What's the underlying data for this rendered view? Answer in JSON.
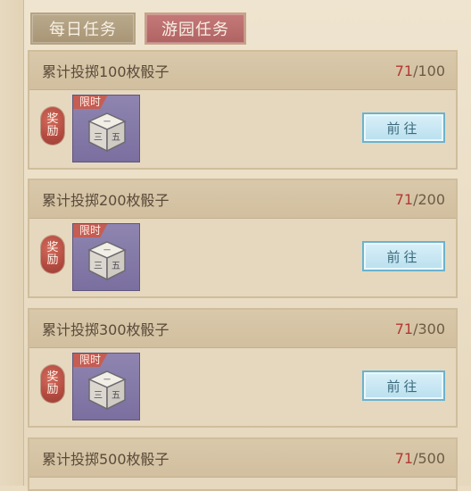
{
  "tabs": [
    {
      "label": "每日任务",
      "active": false
    },
    {
      "label": "游园任务",
      "active": true
    }
  ],
  "reward_label_top": "奖",
  "reward_label_bottom": "励",
  "limited_tag": "限时",
  "go_button_label": "前往",
  "tasks": [
    {
      "title": "累计投掷100枚骰子",
      "current": "71",
      "target": "/100"
    },
    {
      "title": "累计投掷200枚骰子",
      "current": "71",
      "target": "/200"
    },
    {
      "title": "累计投掷300枚骰子",
      "current": "71",
      "target": "/300"
    },
    {
      "title": "累计投掷500枚骰子",
      "current": "71",
      "target": "/500"
    }
  ],
  "dice_faces": {
    "top": "一",
    "left": "三",
    "right": "五"
  },
  "colors": {
    "tab_active": "#b06363",
    "tab_inactive": "#a89576",
    "progress_current": "#b23a34",
    "item_slot": "#7a6f9f",
    "go_button": "#b9dfee"
  }
}
